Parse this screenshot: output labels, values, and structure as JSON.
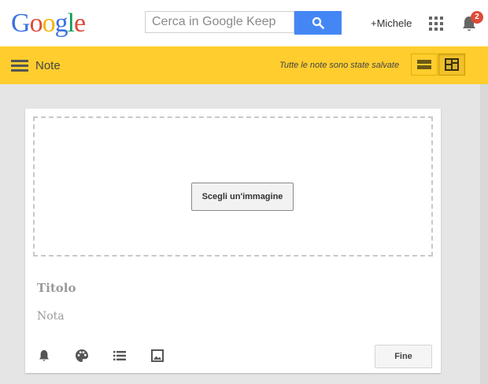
{
  "header": {
    "logo_letters": [
      {
        "ch": "G",
        "color": "#3b73e0"
      },
      {
        "ch": "o",
        "color": "#dd4b39"
      },
      {
        "ch": "o",
        "color": "#f4b400"
      },
      {
        "ch": "g",
        "color": "#3b73e0"
      },
      {
        "ch": "l",
        "color": "#0f9d58"
      },
      {
        "ch": "e",
        "color": "#dd4b39"
      }
    ],
    "search_placeholder": "Cerca in Google Keep",
    "search_icon": "search-icon",
    "user": "+Michele",
    "apps_icon": "apps-grid-icon",
    "notifications_icon": "bell-icon",
    "notifications_count": "2"
  },
  "toolbar": {
    "menu_icon": "hamburger-menu-icon",
    "section": "Note",
    "status": "Tutte le note sono state salvate",
    "view_list_icon": "list-view-icon",
    "view_grid_icon": "grid-view-icon"
  },
  "note_card": {
    "choose_image_label": "Scegli un'immagine",
    "title_placeholder": "Titolo",
    "body_placeholder": "Nota",
    "tools": [
      "reminder-bell-icon",
      "palette-icon",
      "checklist-icon",
      "image-icon"
    ],
    "done_label": "Fine"
  },
  "colors": {
    "accent_yellow": "#ffcd2e",
    "search_blue": "#4487f4",
    "badge_red": "#dd4b39"
  }
}
